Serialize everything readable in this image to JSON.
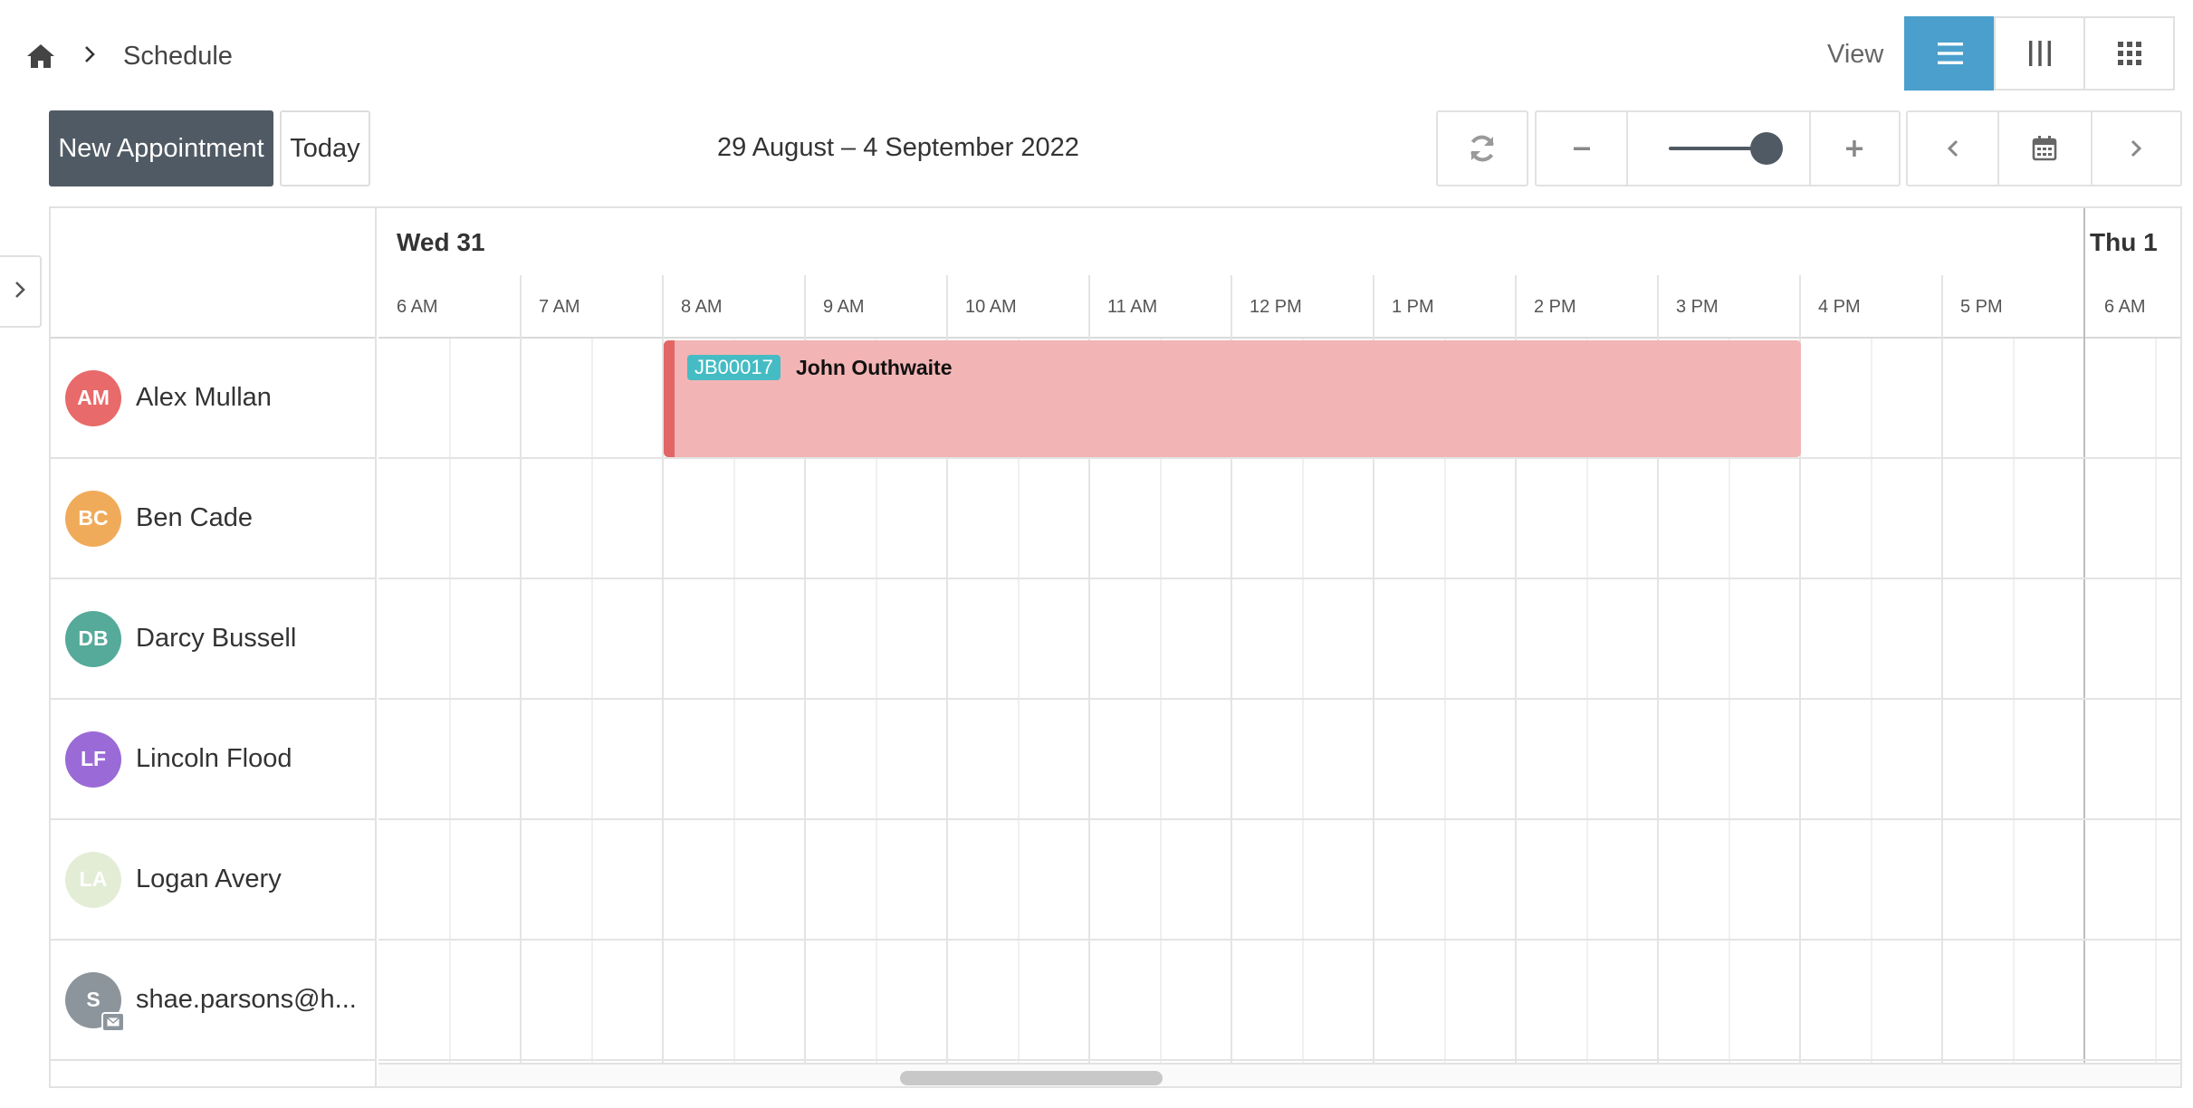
{
  "breadcrumb": {
    "home_icon": "home-icon",
    "separator_icon": "chevron-right-icon",
    "current": "Schedule"
  },
  "view": {
    "label": "View",
    "options": [
      {
        "name": "list-view",
        "icon": "bars-icon",
        "active": true
      },
      {
        "name": "column-view",
        "icon": "columns-icon",
        "active": false
      },
      {
        "name": "grid-view",
        "icon": "grid-icon",
        "active": false
      }
    ]
  },
  "toolbar": {
    "new_appointment": "New Appointment",
    "today": "Today",
    "date_range": "29 August – 4 September 2022"
  },
  "timeline": {
    "days": [
      {
        "label": "Wed 31"
      },
      {
        "label": "Thu 1"
      }
    ],
    "hours": [
      "6 AM",
      "7 AM",
      "8 AM",
      "9 AM",
      "10 AM",
      "11 AM",
      "12 PM",
      "1 PM",
      "2 PM",
      "3 PM",
      "4 PM",
      "5 PM",
      "6 AM"
    ]
  },
  "resources": [
    {
      "initials": "AM",
      "name": "Alex Mullan",
      "color": "#e86a6a"
    },
    {
      "initials": "BC",
      "name": "Ben Cade",
      "color": "#f0ab5a"
    },
    {
      "initials": "DB",
      "name": "Darcy Bussell",
      "color": "#55aa99"
    },
    {
      "initials": "LF",
      "name": "Lincoln Flood",
      "color": "#9a6ad6"
    },
    {
      "initials": "LA",
      "name": "Logan Avery",
      "color": "#e3edd6"
    },
    {
      "initials": "S",
      "name": "shae.parsons@h...",
      "color": "#8d959c",
      "email_badge": true
    }
  ],
  "event": {
    "id": "JB00017",
    "title": "John Outhwaite",
    "resource": "Alex Mullan",
    "day": "Wed 31",
    "start": "8 AM",
    "end": "4 PM",
    "color": "#f2b4b4",
    "accent": "#e36666",
    "id_color": "#45bcc4"
  },
  "colors": {
    "primary": "#4a9fcc",
    "dark": "#505a64"
  }
}
